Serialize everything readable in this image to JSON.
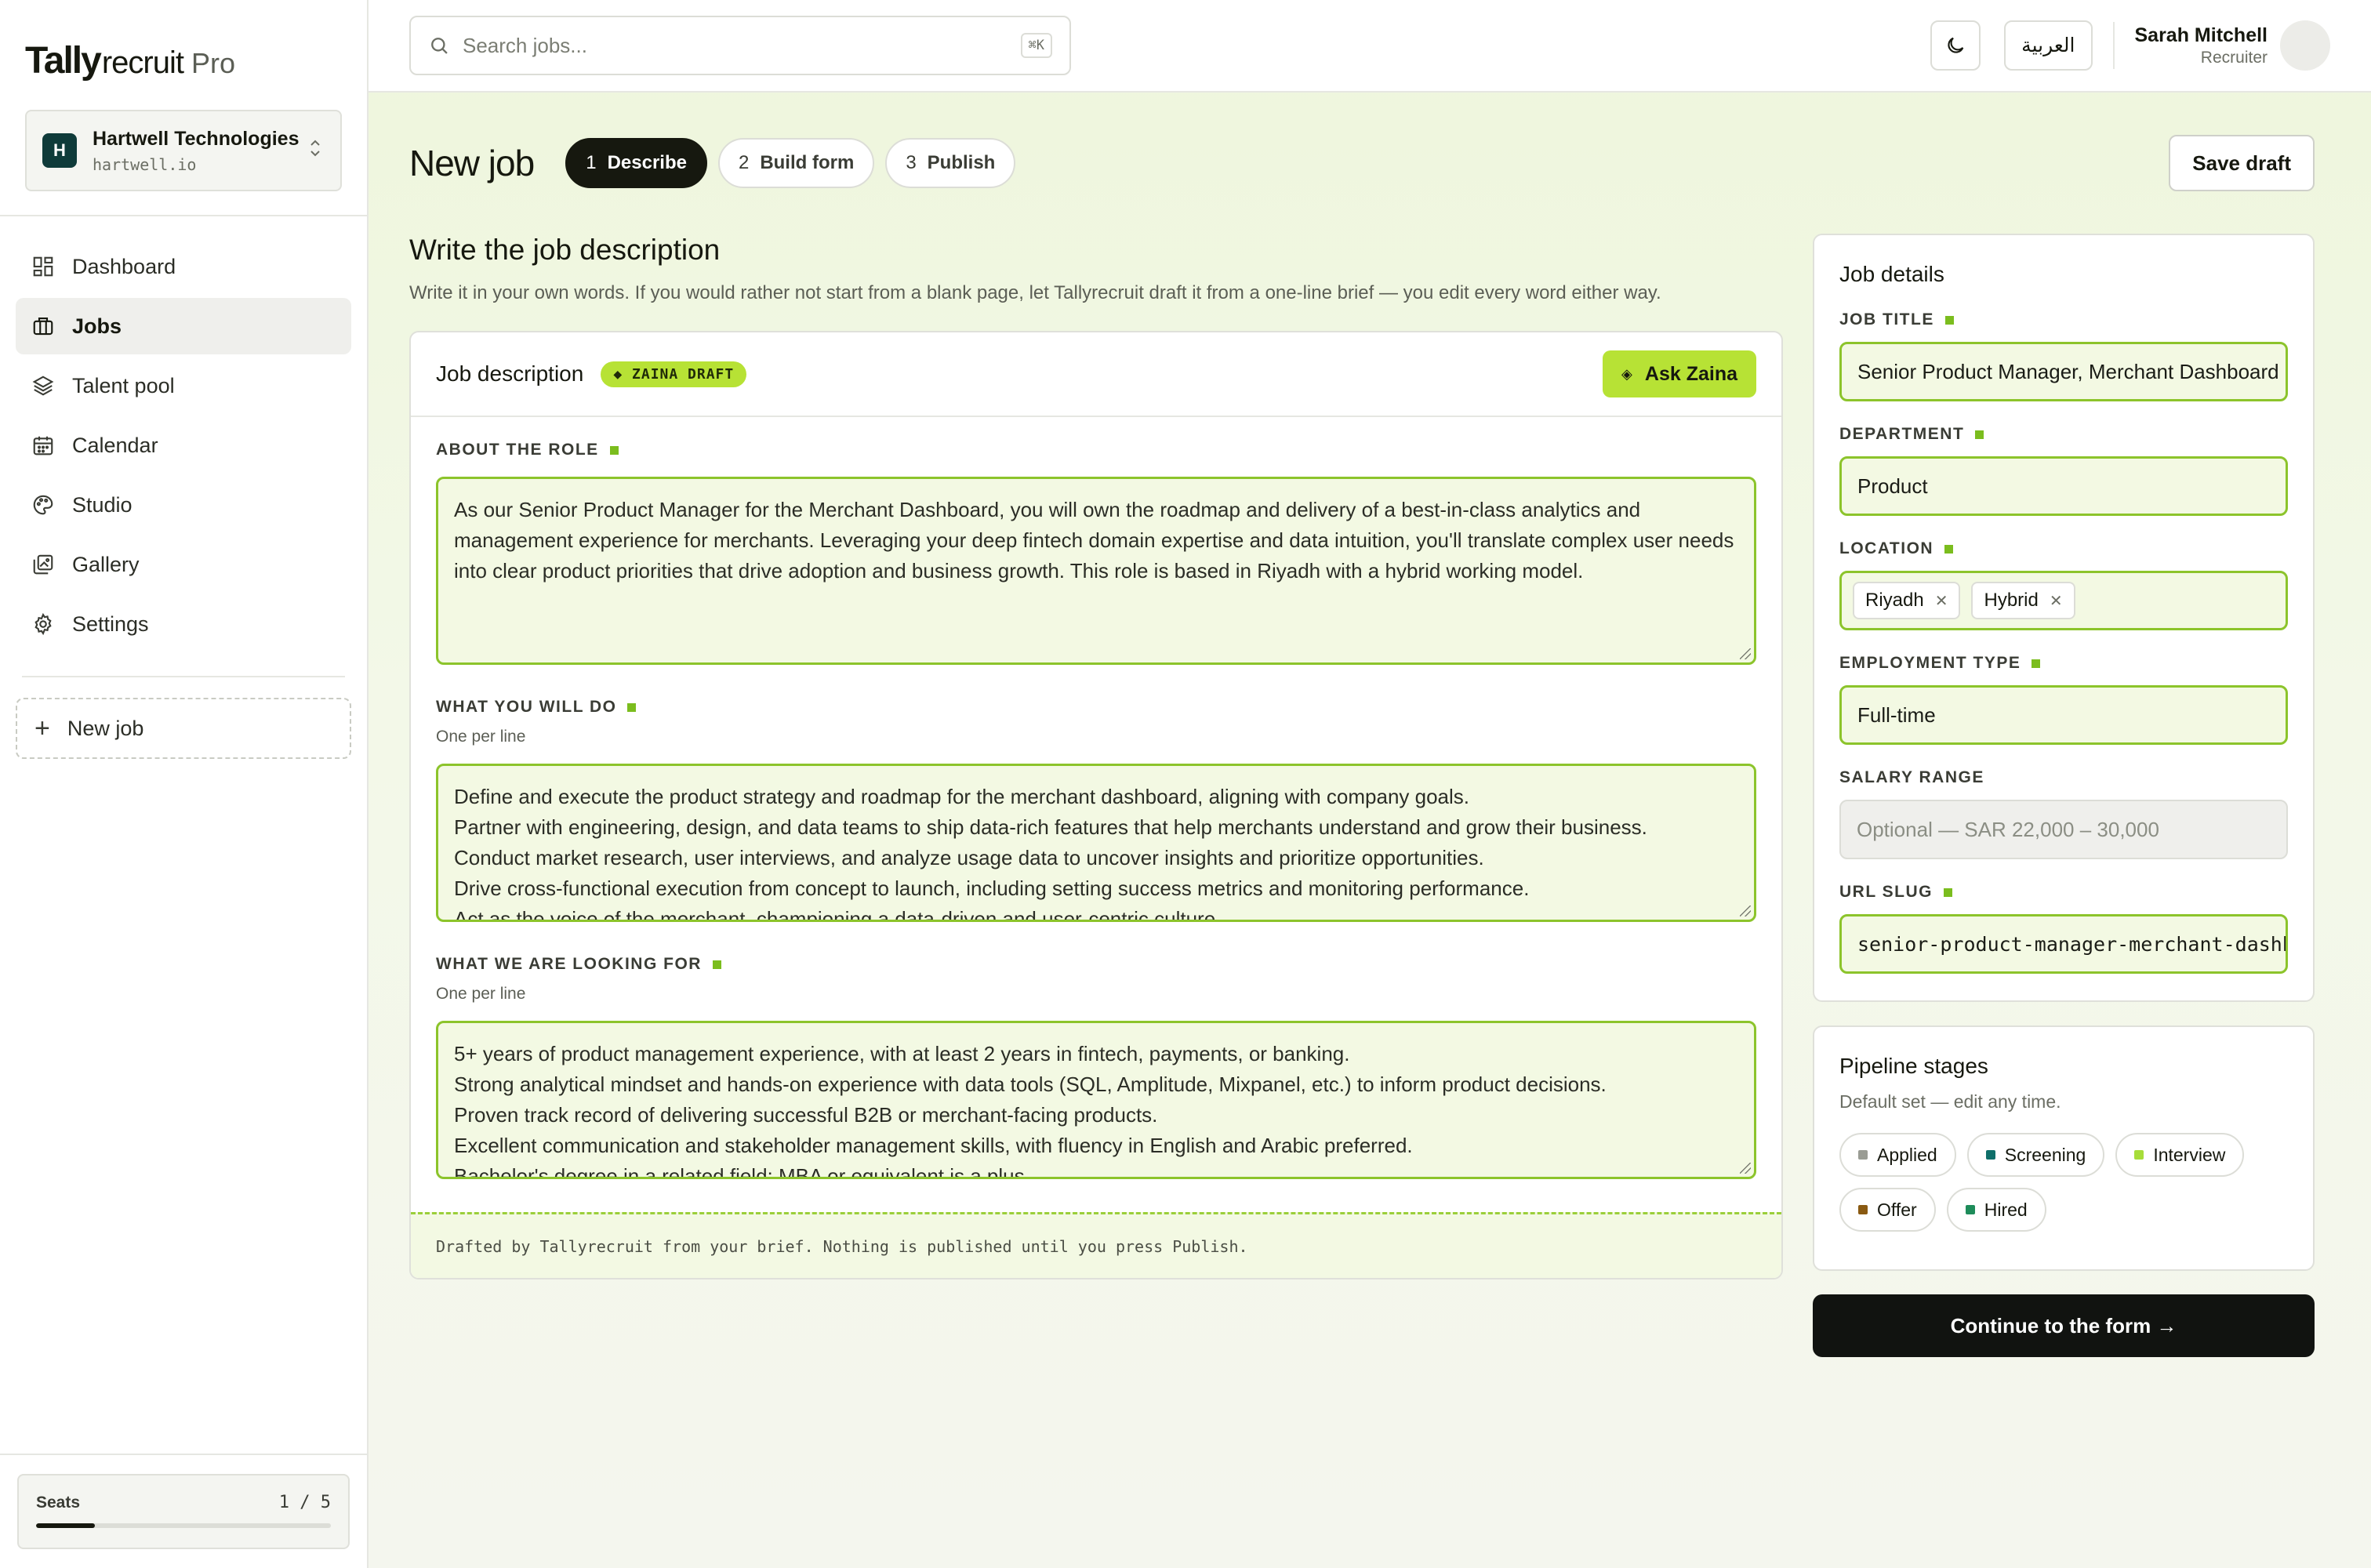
{
  "brand": {
    "part1": "Tally",
    "part2": "recruit",
    "tier": "Pro"
  },
  "org": {
    "initial": "H",
    "name": "Hartwell Technologies",
    "domain": "hartwell.io"
  },
  "nav": {
    "items": [
      {
        "label": "Dashboard",
        "icon": "grid-icon"
      },
      {
        "label": "Jobs",
        "icon": "briefcase-icon",
        "active": true
      },
      {
        "label": "Talent pool",
        "icon": "layers-icon"
      },
      {
        "label": "Calendar",
        "icon": "calendar-icon"
      },
      {
        "label": "Studio",
        "icon": "palette-icon"
      },
      {
        "label": "Gallery",
        "icon": "gallery-icon"
      },
      {
        "label": "Settings",
        "icon": "gear-icon"
      }
    ],
    "new_job": "New job"
  },
  "seats": {
    "label": "Seats",
    "used": "1",
    "sep": "/",
    "total": "5",
    "fraction": 0.2
  },
  "topbar": {
    "search_placeholder": "Search jobs...",
    "shortcut": "⌘K",
    "lang": "العربية",
    "user_name": "Sarah Mitchell",
    "user_role": "Recruiter"
  },
  "header": {
    "title": "New job",
    "steps": [
      {
        "num": "1",
        "label": "Describe",
        "active": true
      },
      {
        "num": "2",
        "label": "Build form"
      },
      {
        "num": "3",
        "label": "Publish"
      }
    ],
    "save": "Save draft"
  },
  "describe": {
    "title": "Write the job description",
    "subtitle": "Write it in your own words. If you would rather not start from a blank page, let Tallyrecruit draft it from a one-line brief — you edit every word either way.",
    "card_title": "Job description",
    "badge": "◆ ZAINA DRAFT",
    "ask": "Ask Zaina",
    "about_label": "ABOUT THE ROLE",
    "about_text": "As our Senior Product Manager for the Merchant Dashboard, you will own the roadmap and delivery of a best-in-class analytics and management experience for merchants. Leveraging your deep fintech domain expertise and data intuition, you'll translate complex user needs into clear product priorities that drive adoption and business growth. This role is based in Riyadh with a hybrid working model.",
    "do_label": "WHAT YOU WILL DO",
    "do_hint": "One per line",
    "do_lines": [
      "Define and execute the product strategy and roadmap for the merchant dashboard, aligning with company goals.",
      "Partner with engineering, design, and data teams to ship data-rich features that help merchants understand and grow their business.",
      "Conduct market research, user interviews, and analyze usage data to uncover insights and prioritize opportunities.",
      "Drive cross-functional execution from concept to launch, including setting success metrics and monitoring performance.",
      "Act as the voice of the merchant, championing a data-driven and user-centric culture."
    ],
    "look_label": "WHAT WE ARE LOOKING FOR",
    "look_hint": "One per line",
    "look_lines": [
      "5+ years of product management experience, with at least 2 years in fintech, payments, or banking.",
      "Strong analytical mindset and hands-on experience with data tools (SQL, Amplitude, Mixpanel, etc.) to inform product decisions.",
      "Proven track record of delivering successful B2B or merchant-facing products.",
      "Excellent communication and stakeholder management skills, with fluency in English and Arabic preferred.",
      "Bachelor's degree in a related field; MBA or equivalent is a plus."
    ],
    "footer": "Drafted by Tallyrecruit from your brief. Nothing is published until you press Publish."
  },
  "details": {
    "title": "Job details",
    "job_title_label": "JOB TITLE",
    "job_title": "Senior Product Manager, Merchant Dashboard",
    "department_label": "DEPARTMENT",
    "department": "Product",
    "location_label": "LOCATION",
    "locations": [
      "Riyadh",
      "Hybrid"
    ],
    "employment_label": "EMPLOYMENT TYPE",
    "employment": "Full-time",
    "salary_label": "SALARY RANGE",
    "salary_placeholder": "Optional — SAR 22,000 – 30,000",
    "slug_label": "URL SLUG",
    "slug": "senior-product-manager-merchant-dashboard"
  },
  "pipeline": {
    "title": "Pipeline stages",
    "subtitle": "Default set — edit any time.",
    "stages": [
      {
        "label": "Applied",
        "color": "#9a9c94"
      },
      {
        "label": "Screening",
        "color": "#0f6f6a"
      },
      {
        "label": "Interview",
        "color": "#a7dd3a"
      },
      {
        "label": "Offer",
        "color": "#8a5a12"
      },
      {
        "label": "Hired",
        "color": "#1e8c5a"
      }
    ]
  },
  "continue": "Continue to the form →",
  "colors": {
    "accent": "#b7e235",
    "accent_border": "#8cc42b",
    "ink": "#16180f"
  }
}
